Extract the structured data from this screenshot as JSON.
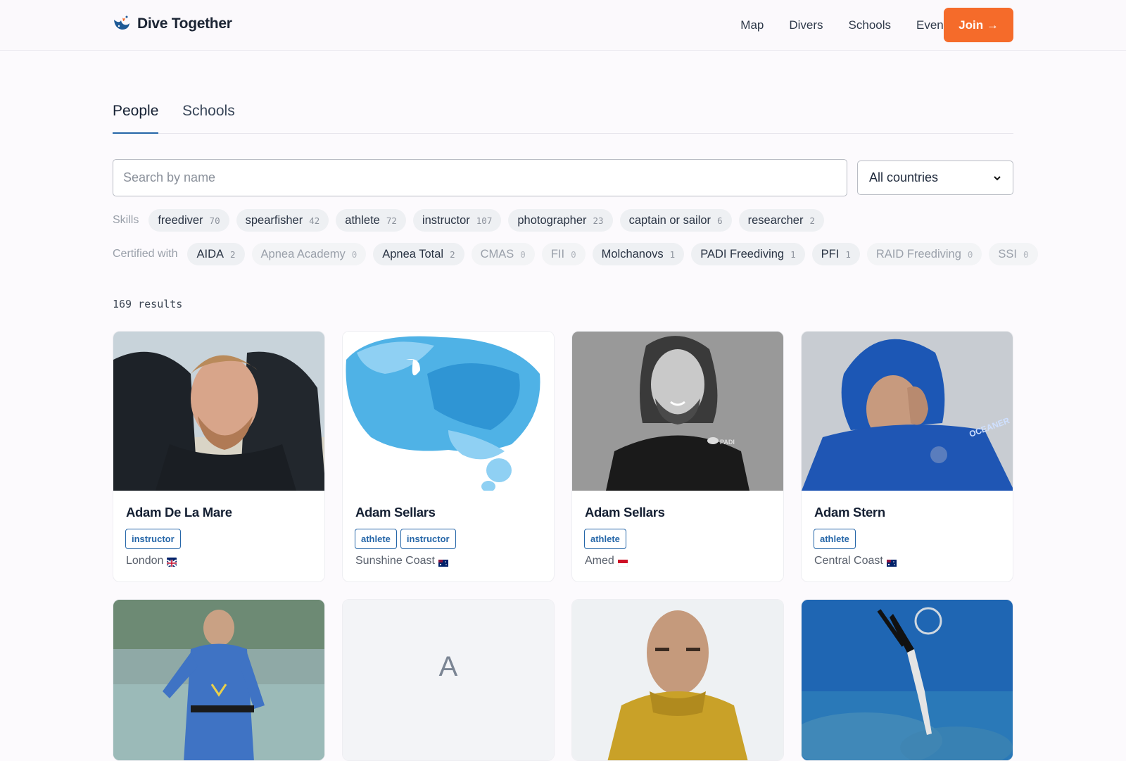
{
  "header": {
    "brand": "Dive Together",
    "nav": [
      "Map",
      "Divers",
      "Schools",
      "Events"
    ],
    "instagram_icon": "instagram-icon",
    "join_label": "Join →",
    "accent": "#f56b2a"
  },
  "tabs": {
    "people": "People",
    "schools": "Schools"
  },
  "search": {
    "placeholder": "Search by name",
    "country_value": "All countries"
  },
  "skills": {
    "label": "Skills",
    "items": [
      {
        "name": "freediver",
        "count": "70"
      },
      {
        "name": "spearfisher",
        "count": "42"
      },
      {
        "name": "athlete",
        "count": "72"
      },
      {
        "name": "instructor",
        "count": "107"
      },
      {
        "name": "photographer",
        "count": "23"
      },
      {
        "name": "captain or sailor",
        "count": "6"
      },
      {
        "name": "researcher",
        "count": "2"
      }
    ]
  },
  "certs": {
    "label": "Certified with",
    "items": [
      {
        "name": "AIDA",
        "count": "2"
      },
      {
        "name": "Apnea Academy",
        "count": "0"
      },
      {
        "name": "Apnea Total",
        "count": "2"
      },
      {
        "name": "CMAS",
        "count": "0"
      },
      {
        "name": "FII",
        "count": "0"
      },
      {
        "name": "Molchanovs",
        "count": "1"
      },
      {
        "name": "PADI Freediving",
        "count": "1"
      },
      {
        "name": "PFI",
        "count": "1"
      },
      {
        "name": "RAID Freediving",
        "count": "0"
      },
      {
        "name": "SSI",
        "count": "0"
      }
    ]
  },
  "results": "169 results",
  "cards": [
    {
      "name": "Adam De La Mare",
      "tags": [
        "instructor"
      ],
      "location": "London",
      "flag": "uk-flag"
    },
    {
      "name": "Adam Sellars",
      "tags": [
        "athlete",
        "instructor"
      ],
      "location": "Sunshine Coast",
      "flag": "au-flag"
    },
    {
      "name": "Adam Sellars",
      "tags": [
        "athlete"
      ],
      "location": "Amed",
      "flag": "id-flag"
    },
    {
      "name": "Adam Stern",
      "tags": [
        "athlete"
      ],
      "location": "Central Coast",
      "flag": "au-flag"
    },
    {
      "placeholder": "A"
    }
  ]
}
